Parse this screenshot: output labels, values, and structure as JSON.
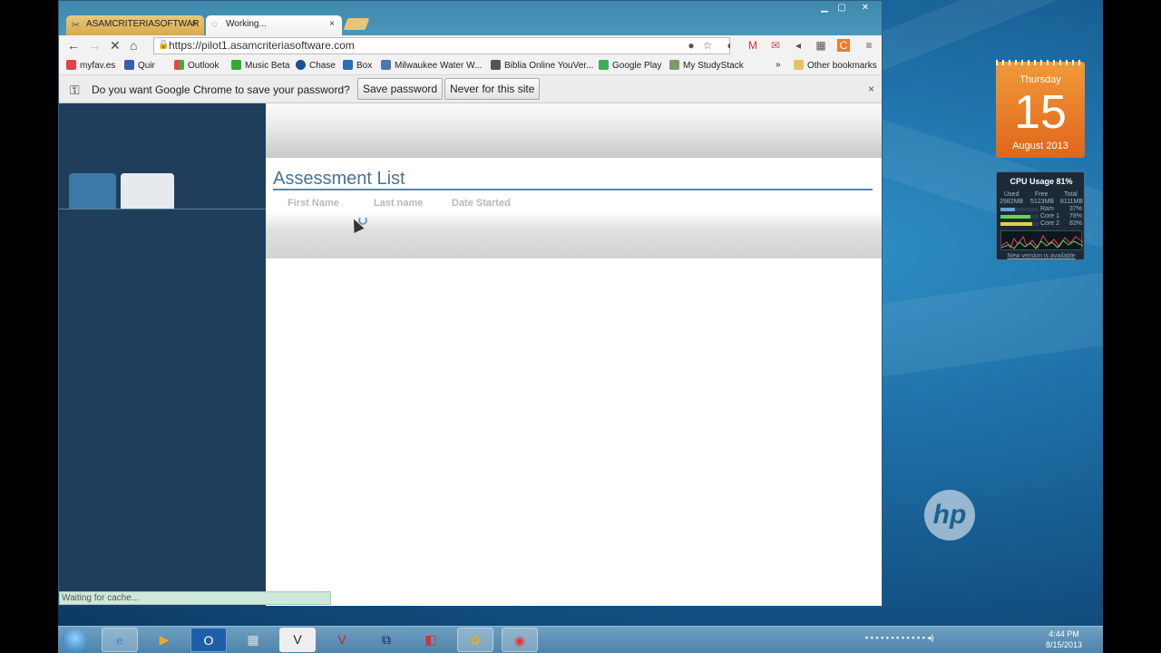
{
  "browser": {
    "tabs": [
      {
        "label": "ASAMCRITERIASOFTWAR",
        "active": false
      },
      {
        "label": "Working...",
        "active": true
      }
    ],
    "url": "https://pilot1.asamcriteriasoftware.com",
    "bookmarks": [
      {
        "label": "myfav.es",
        "icon": "myfav-icon"
      },
      {
        "label": "Quir",
        "icon": "quir-icon"
      },
      {
        "label": "Outlook",
        "icon": "windows-icon"
      },
      {
        "label": "Music Beta",
        "icon": "play-icon"
      },
      {
        "label": "Chase",
        "icon": "chase-icon"
      },
      {
        "label": "Box",
        "icon": "box-icon"
      },
      {
        "label": "Milwaukee Water W...",
        "icon": "page-icon"
      },
      {
        "label": "Biblia Online YouVer...",
        "icon": "book-icon"
      },
      {
        "label": "Google Play",
        "icon": "play-icon"
      },
      {
        "label": "My StudyStack",
        "icon": "studystack-icon"
      }
    ],
    "bookmarks_overflow": "»",
    "other_bookmarks": "Other bookmarks",
    "infobar": {
      "message": "Do you want Google Chrome to save your password?",
      "save_label": "Save password",
      "never_label": "Never for this site",
      "close": "×"
    },
    "status_text": "Waiting for cache..."
  },
  "page": {
    "title": "Assessment List",
    "columns": [
      "First Name",
      "Last name",
      "Date Started"
    ]
  },
  "calendar": {
    "weekday": "Thursday",
    "day": "15",
    "month_year": "August 2013"
  },
  "cpu_gadget": {
    "title": "CPU Usage 81%",
    "headers": [
      "Used",
      "Free",
      "Total"
    ],
    "header_values": [
      "2982MB",
      "5123MB",
      "8111MB"
    ],
    "rows": [
      {
        "label": "Ram",
        "pct": "37%",
        "fill": 0.37,
        "color": "#6aa0d8"
      },
      {
        "label": "Core 1",
        "pct": "78%",
        "fill": 0.78,
        "color": "#6ccf5a"
      },
      {
        "label": "Core 2",
        "pct": "83%",
        "fill": 0.83,
        "color": "#e4d04a"
      }
    ],
    "link": "New version is available"
  },
  "taskbar": {
    "clock_time": "4:44 PM",
    "clock_date": "8/15/2013"
  },
  "colors": {
    "sidebar": "#1f3e5b",
    "title_blue": "#46729a",
    "calendar_orange": "#e0661a"
  }
}
